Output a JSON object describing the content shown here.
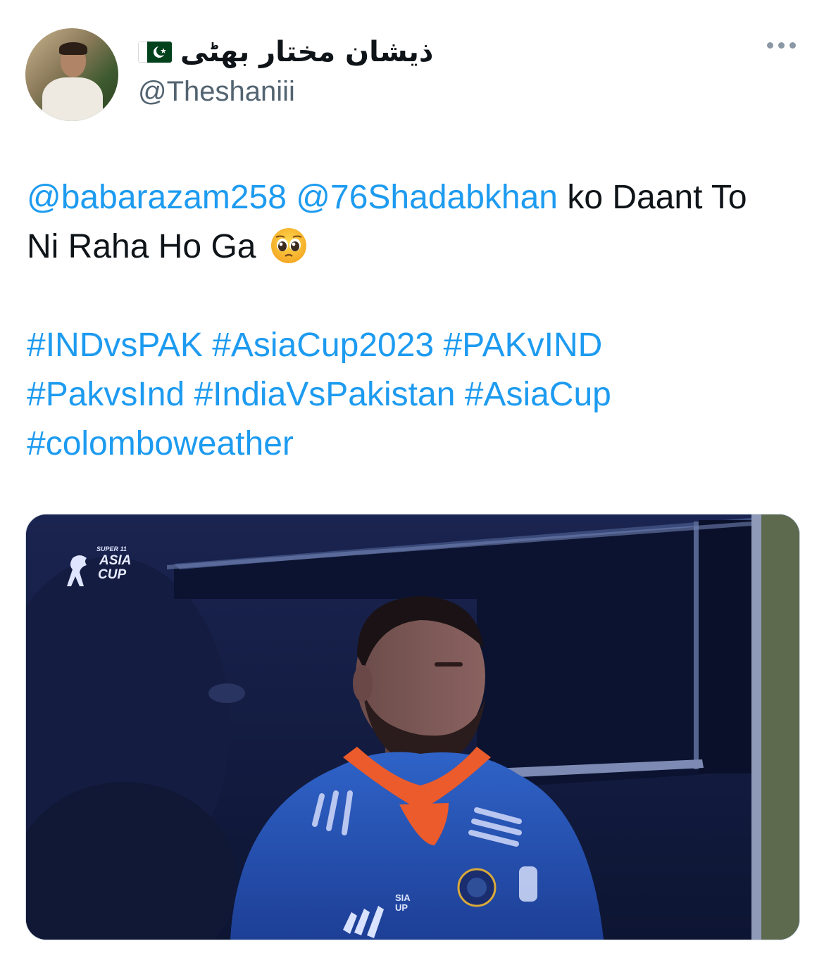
{
  "author": {
    "display_name": "ذیشان مختار بھٹی",
    "handle": "@Theshaniii",
    "flag_icon": "pakistan-flag-icon"
  },
  "more_icon": "ellipsis-icon",
  "tweet": {
    "mention_1": "@babarazam258",
    "mention_2": "@76Shadabkhan",
    "text_after_mentions": " ko Daant To",
    "text_line2": "Ni Raha Ho Ga ",
    "emoji": "pleading-face-emoji",
    "hashtags": [
      "#INDvsPAK",
      "#AsiaCup2023",
      "#PAKvIND",
      "#PakvsInd",
      "#IndiaVsPakistan",
      "#AsiaCup",
      "#colomboweather"
    ]
  },
  "media": {
    "logo_small": "SUPER 11",
    "logo_main": "ASIA",
    "logo_sub": "CUP",
    "jersey_logo_a": "SIA",
    "jersey_logo_b": "UP"
  },
  "colors": {
    "link": "#1d9bf0",
    "text": "#0f1419",
    "secondary": "#536471"
  }
}
